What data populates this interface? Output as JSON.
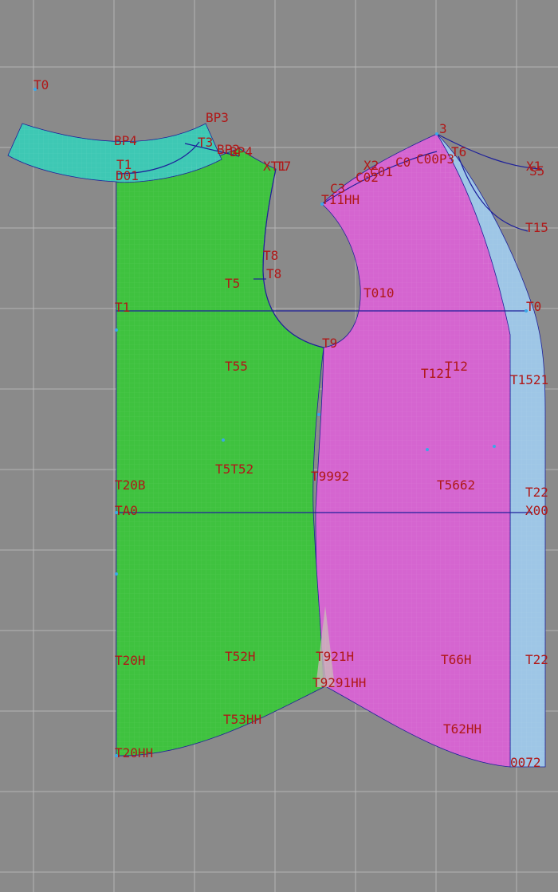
{
  "colors": {
    "background": "#8a8a8a",
    "grid": "#b4b4b4",
    "front_fill": "#3fc23f",
    "back_fill": "#d565d0",
    "collar_fill": "#3ec8b4",
    "side_fill": "#9ec6e6",
    "outline": "#1d1f9a",
    "label": "#b01818"
  },
  "pieces": [
    {
      "name": "front-panel",
      "color": "front_fill"
    },
    {
      "name": "back-panel",
      "color": "back_fill"
    },
    {
      "name": "collar-band",
      "color": "collar_fill"
    },
    {
      "name": "back-side-strip",
      "color": "side_fill"
    }
  ],
  "labels": {
    "l01": "T0",
    "l02": "BP3",
    "l03": "BP4",
    "l04": "T3",
    "l05": "BP2",
    "l06": "BP4",
    "l07": "T1",
    "l08": "D01",
    "l09": "XT1",
    "l10": "T7",
    "l11": "3",
    "l12": "T6",
    "l13": "X1",
    "l14": "S5",
    "l15": "X2",
    "l16": "C0",
    "l17": "C00P3",
    "l18": "C01",
    "l19": "C02",
    "l20": "C3",
    "l21": "T11HH",
    "l22": "T15",
    "l23": "T8",
    "l24": "T5",
    "l25": "T8",
    "l26": "T010",
    "l27": "T1",
    "l28": "T0",
    "l29": "T9",
    "l30": "T55",
    "l31": "T12",
    "l32": "T121",
    "l33": "T1521",
    "l34": "T20B",
    "l35": "T5T52",
    "l36": "T9992",
    "l37": "T5662",
    "l38": "T22",
    "l39": "TA0",
    "l40": "X00",
    "l41": "T20H",
    "l42": "T52H",
    "l43": "T921H",
    "l44": "T66H",
    "l45": "T22",
    "l46": "T9291HH",
    "l47": "T53HH",
    "l48": "T62HH",
    "l49": "T20HH",
    "l50": "0072"
  }
}
